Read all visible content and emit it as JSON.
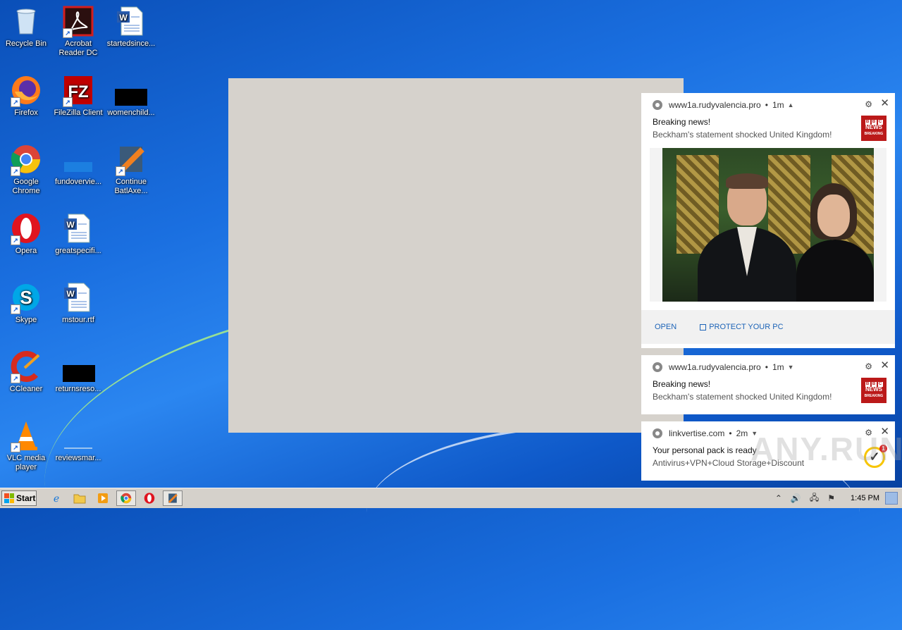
{
  "desktop": {
    "icons": [
      {
        "label": "Recycle Bin"
      },
      {
        "label": "Acrobat Reader DC"
      },
      {
        "label": "startedsince..."
      },
      {
        "label": "Firefox"
      },
      {
        "label": "FileZilla Client"
      },
      {
        "label": "womenchild..."
      },
      {
        "label": "Google Chrome"
      },
      {
        "label": "fundovervie..."
      },
      {
        "label": "Continue BatlAxe..."
      },
      {
        "label": "Opera"
      },
      {
        "label": "greatspecifi..."
      },
      {
        "label": "Skype"
      },
      {
        "label": "mstour.rtf"
      },
      {
        "label": "CCleaner"
      },
      {
        "label": "returnsreso..."
      },
      {
        "label": "VLC media player"
      },
      {
        "label": "reviewsmar..."
      }
    ]
  },
  "notifications": [
    {
      "source": "www1a.rudyvalencia.pro",
      "time": "1m",
      "title": "Breaking news!",
      "message": "Beckham's statement shocked United Kingdom!",
      "logo_text": "NEWS",
      "logo_sub": "BREAKING",
      "logo_letters": [
        "B",
        "B",
        "C"
      ],
      "open_label": "OPEN",
      "protect_label": "PROTECT YOUR PC"
    },
    {
      "source": "www1a.rudyvalencia.pro",
      "time": "1m",
      "title": "Breaking news!",
      "message": "Beckham's statement shocked United Kingdom!",
      "logo_text": "NEWS",
      "logo_sub": "BREAKING",
      "logo_letters": [
        "B",
        "B",
        "C"
      ]
    },
    {
      "source": "linkvertise.com",
      "time": "2m",
      "title": "Your personal pack is ready",
      "message": "Antivirus+VPN+Cloud Storage+Discount",
      "badge": "1"
    }
  ],
  "watermark": "ANY.RUN",
  "taskbar": {
    "start_label": "Start",
    "clock": "1:45 PM"
  }
}
